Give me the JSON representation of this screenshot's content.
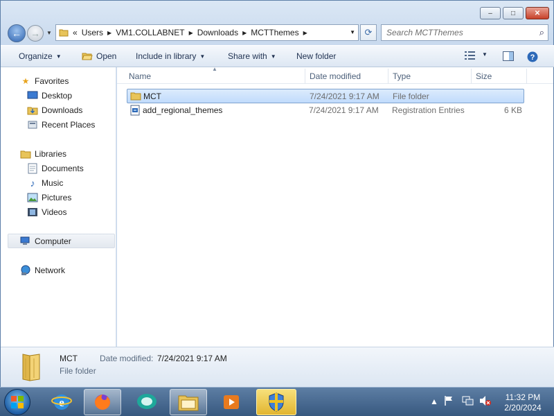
{
  "window": {
    "buttons": {
      "minimize": "‒",
      "maximize": "□",
      "close": "✕"
    }
  },
  "address": {
    "overflow": "«",
    "breadcrumbs": [
      "Users",
      "VM1.COLLABNET",
      "Downloads",
      "MCTThemes"
    ],
    "search_placeholder": "Search MCTThemes"
  },
  "toolbar": {
    "organize": "Organize",
    "open": "Open",
    "include_in_library": "Include in library",
    "share_with": "Share with",
    "new_folder": "New folder"
  },
  "nav": {
    "favorites": "Favorites",
    "desktop": "Desktop",
    "downloads": "Downloads",
    "recent_places": "Recent Places",
    "libraries": "Libraries",
    "documents": "Documents",
    "music": "Music",
    "pictures": "Pictures",
    "videos": "Videos",
    "computer": "Computer",
    "network": "Network"
  },
  "columns": {
    "name": "Name",
    "date_modified": "Date modified",
    "type": "Type",
    "size": "Size"
  },
  "files": [
    {
      "name": "MCT",
      "date": "7/24/2021 9:17 AM",
      "type": "File folder",
      "size": "",
      "selected": true,
      "icon": "folder-icon"
    },
    {
      "name": "add_regional_themes",
      "date": "7/24/2021 9:17 AM",
      "type": "Registration Entries",
      "size": "6 KB",
      "selected": false,
      "icon": "registry-file-icon"
    }
  ],
  "details": {
    "name": "MCT",
    "date_label": "Date modified:",
    "date_value": "7/24/2021 9:17 AM",
    "type": "File folder"
  },
  "clock": {
    "time": "11:32 PM",
    "date": "2/20/2024"
  },
  "colors": {
    "selection": "#cce4fc",
    "accent": "#1f5ea6",
    "folder": "#e8c45a"
  }
}
